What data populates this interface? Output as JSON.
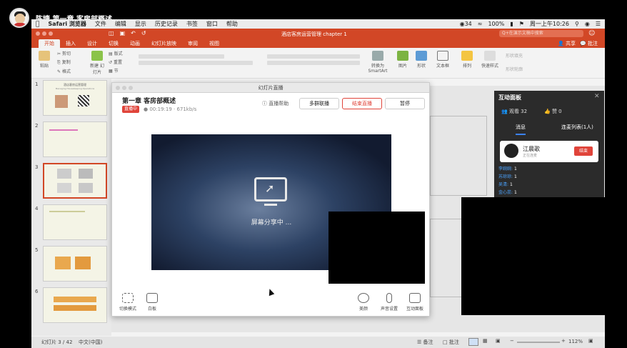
{
  "outer": {
    "title": "陈婕 第一章 客房部概述"
  },
  "menubar": {
    "items": [
      "Safari 浏览器",
      "文件",
      "编辑",
      "显示",
      "历史记录",
      "书签",
      "窗口",
      "帮助"
    ],
    "battery_num": "34",
    "battery": "100%",
    "clock": "周一上午10:26"
  },
  "ppt": {
    "doc_title": "酒店客房运营管理 chapter 1",
    "search_placeholder": "Q+在演示文稿中搜索",
    "tabs": [
      "开始",
      "插入",
      "设计",
      "切换",
      "动画",
      "幻灯片放映",
      "审阅",
      "视图"
    ],
    "share": "共享",
    "comment": "批注",
    "ribbon": {
      "paste": "粘贴",
      "cut": "剪切",
      "copy": "复制",
      "format": "格式",
      "new_slide": "新建\n幻灯片",
      "layout": "版式",
      "reset": "重置",
      "section": "节",
      "convert": "转换为\nSmartArt",
      "picture": "图片",
      "shape": "形状",
      "textbox": "文本框",
      "arrange": "排列",
      "quick_styles": "快速样式",
      "shape_fill": "形状填充",
      "shape_outline": "形状轮廓"
    },
    "slides": [
      "1",
      "2",
      "3",
      "4",
      "5",
      "6"
    ],
    "thumb1_title": "酒店客房运营管理",
    "thumb1_sub": "Managing Housekeeping Operations",
    "status": {
      "slide": "幻灯片 3 / 42",
      "lang": "中文(中国)",
      "notes": "备注",
      "comments": "批注",
      "zoom": "112%"
    }
  },
  "live": {
    "window_title": "幻灯片直播",
    "title": "第一章 客房部概述",
    "badge": "直播中",
    "meta": "● 00:19:19 · 671kb/s",
    "help": "直播帮助",
    "btn_multi": "多群联播",
    "btn_end": "结束直播",
    "btn_pause": "暂停",
    "share_text": "屏幕分享中 ...",
    "tools": {
      "switch": "切换模式",
      "board": "白板",
      "beauty": "美颜",
      "audio": "声音设置",
      "interact": "互动面板"
    }
  },
  "panel": {
    "title": "互动面板",
    "viewers": "观看 32",
    "likes": "赞 0",
    "tab_msg": "消息",
    "tab_mic": "连麦列表(1人)",
    "guest_name": "江晨歌",
    "guest_status": "正在连麦",
    "end": "结束",
    "list": [
      {
        "name": "李婉婉:",
        "val": "1"
      },
      {
        "name": "苏琼琼:",
        "val": "1"
      },
      {
        "name": "吴清:",
        "val": "1"
      },
      {
        "name": "金心蕊:",
        "val": "1"
      }
    ]
  }
}
